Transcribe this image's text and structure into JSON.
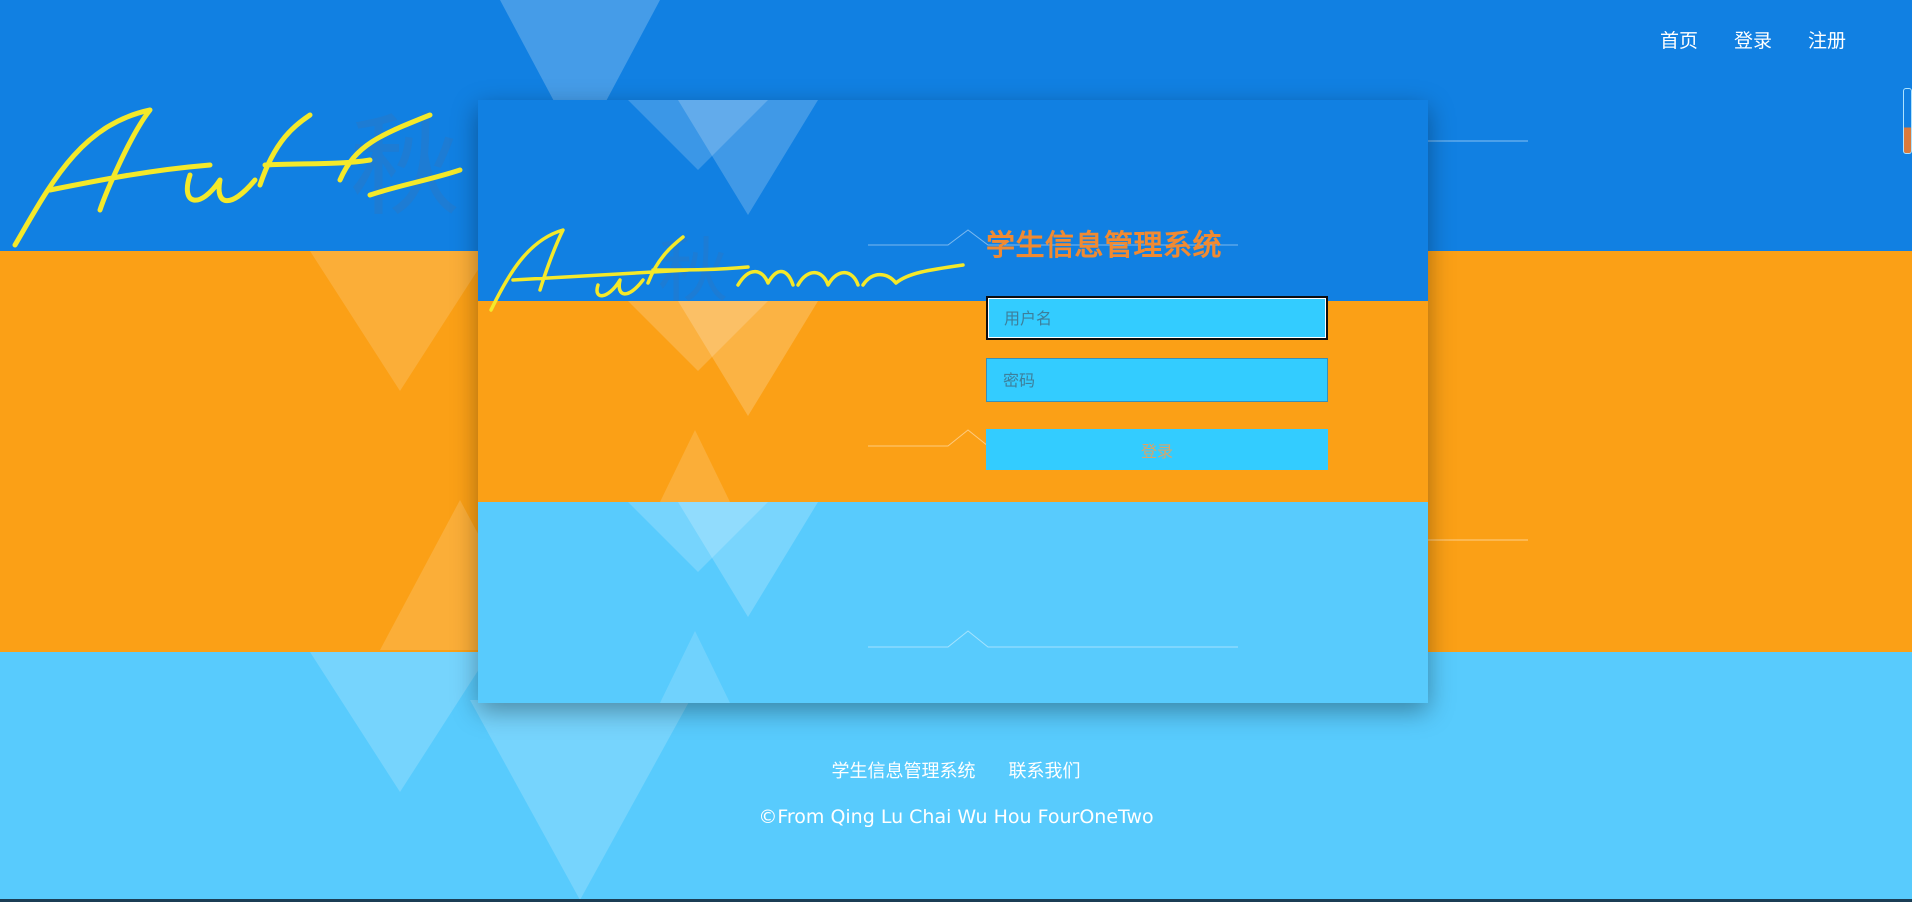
{
  "nav": {
    "home": "首页",
    "login": "登录",
    "register": "注册"
  },
  "background": {
    "signature_text": "Autumn",
    "watermark_char": "秋"
  },
  "login_card": {
    "title": "学生信息管理系统",
    "signature_text": "Autumn",
    "watermark_char": "秋",
    "username_placeholder": "用户名",
    "password_placeholder": "密码",
    "login_button": "登录"
  },
  "footer": {
    "link_system": "学生信息管理系统",
    "link_contact": "联系我们",
    "copyright": "©From Qing Lu Chai Wu Hou FourOneTwo"
  },
  "colors": {
    "blue": "#1180e2",
    "orange": "#fba016",
    "light_blue": "#58cbfd",
    "input_bg": "#33ccff",
    "title": "#f08a32",
    "signature": "#f4e92a"
  }
}
